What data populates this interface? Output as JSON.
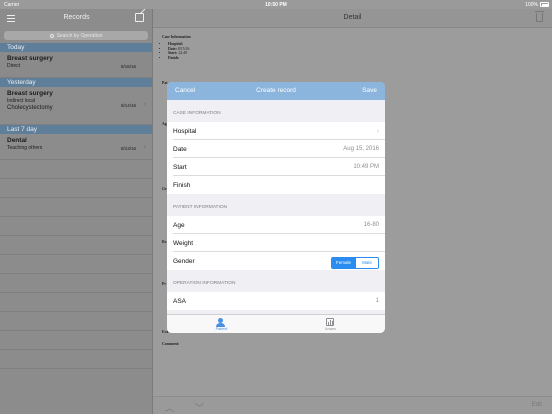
{
  "status": {
    "carrier": "Carrier",
    "time": "10:50 PM",
    "battery": "100%"
  },
  "master": {
    "title": "Records",
    "search_placeholder": "Search by Operation",
    "sections": [
      {
        "label": "Today",
        "records": [
          {
            "title": "Breast surgery",
            "sub": "Direct",
            "date": "8/15/16"
          }
        ]
      },
      {
        "label": "Yesterday",
        "records": [
          {
            "title": "Breast surgery",
            "sub": "Indirect local",
            "sub2": "Cholecystectomy",
            "date": "8/14/16"
          }
        ]
      },
      {
        "label": "Last 7 day",
        "records": [
          {
            "title": "Dental",
            "sub": "Teaching others",
            "date": "8/13/16"
          }
        ]
      }
    ]
  },
  "detail": {
    "title": "Detail",
    "doc_heading": "Case Information",
    "doc_items": [
      {
        "label": "Hospital:",
        "value": ""
      },
      {
        "label": "Date:",
        "value": "8/15/16"
      },
      {
        "label": "Start:",
        "value": "22:49"
      },
      {
        "label": "Finish:",
        "value": ""
      }
    ],
    "side_labels": [
      "Pat",
      "Ag",
      "Ge",
      "Re",
      "Pr",
      "Eva",
      "Comment:"
    ],
    "edit_label": "Edit"
  },
  "modal": {
    "cancel": "Cancel",
    "title": "Create record",
    "save": "Save",
    "case_header": "CASE INFORMATION",
    "hospital": "Hospital",
    "date_label": "Date",
    "date_value": "Aug 15, 2016",
    "start_label": "Start",
    "start_value": "10:49 PM",
    "finish_label": "Finish",
    "patient_header": "PATIENT INFORMATION",
    "age_label": "Age",
    "age_value": "16-80",
    "weight_label": "Weight",
    "gender_label": "Gender",
    "gender_options": [
      "Female",
      "Male"
    ],
    "operation_header": "OPERATION INFORMATION",
    "asa_label": "ASA",
    "asa_value": "1",
    "tabs": [
      {
        "label": "Patient",
        "icon": "person-icon"
      },
      {
        "label": "Anaes",
        "icon": "chart-icon"
      }
    ]
  },
  "colors": {
    "accent": "#2a8cf1",
    "modal_header": "#8bb5dc",
    "section_header": "#5f7e99"
  }
}
